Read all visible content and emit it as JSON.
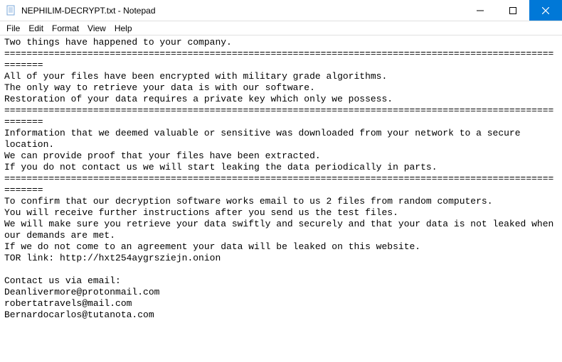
{
  "window": {
    "title": "NEPHILIM-DECRYPT.txt - Notepad"
  },
  "menu": {
    "file": "File",
    "edit": "Edit",
    "format": "Format",
    "view": "View",
    "help": "Help"
  },
  "document": {
    "text": "Two things have happened to your company.\n==========================================================================================================\nAll of your files have been encrypted with military grade algorithms.\nThe only way to retrieve your data is with our software.\nRestoration of your data requires a private key which only we possess.\n==========================================================================================================\nInformation that we deemed valuable or sensitive was downloaded from your network to a secure location.\nWe can provide proof that your files have been extracted.\nIf you do not contact us we will start leaking the data periodically in parts.\n==========================================================================================================\nTo confirm that our decryption software works email to us 2 files from random computers.\nYou will receive further instructions after you send us the test files.\nWe will make sure you retrieve your data swiftly and securely and that your data is not leaked when our demands are met.\nIf we do not come to an agreement your data will be leaked on this website.\nTOR link: http://hxt254aygrsziejn.onion\n\nContact us via email:\nDeanlivermore@protonmail.com\nrobertatravels@mail.com\nBernardocarlos@tutanota.com"
  }
}
